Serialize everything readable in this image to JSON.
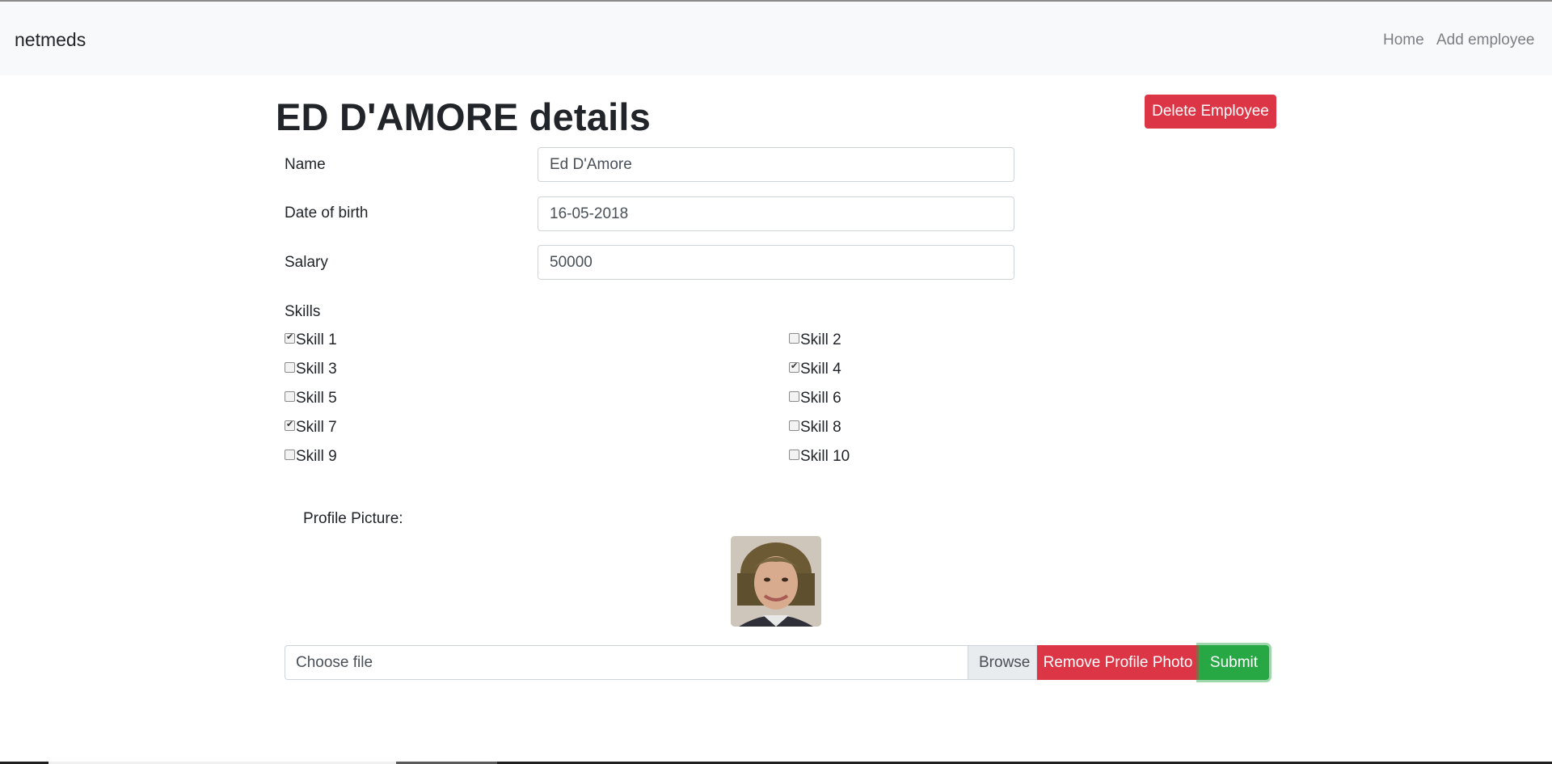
{
  "navbar": {
    "brand": "netmeds",
    "links": [
      {
        "label": "Home"
      },
      {
        "label": "Add employee"
      }
    ]
  },
  "page": {
    "title": "ED D'AMORE details",
    "delete_label": "Delete Employee"
  },
  "form": {
    "name": {
      "label": "Name",
      "value": "Ed D'Amore"
    },
    "dob": {
      "label": "Date of birth",
      "value": "16-05-2018"
    },
    "salary": {
      "label": "Salary",
      "value": "50000"
    },
    "skills_label": "Skills",
    "skills": [
      {
        "label": "Skill 1",
        "checked": true
      },
      {
        "label": "Skill 2",
        "checked": false
      },
      {
        "label": "Skill 3",
        "checked": false
      },
      {
        "label": "Skill 4",
        "checked": true
      },
      {
        "label": "Skill 5",
        "checked": false
      },
      {
        "label": "Skill 6",
        "checked": false
      },
      {
        "label": "Skill 7",
        "checked": true
      },
      {
        "label": "Skill 8",
        "checked": false
      },
      {
        "label": "Skill 9",
        "checked": false
      },
      {
        "label": "Skill 10",
        "checked": false
      }
    ],
    "profile_label": "Profile Picture:",
    "file_placeholder": "Choose file",
    "browse_label": "Browse",
    "remove_label": "Remove Profile Photo",
    "submit_label": "Submit"
  },
  "colors": {
    "danger": "#dc3545",
    "success": "#28a745",
    "navbar_bg": "#f8f9fa"
  }
}
